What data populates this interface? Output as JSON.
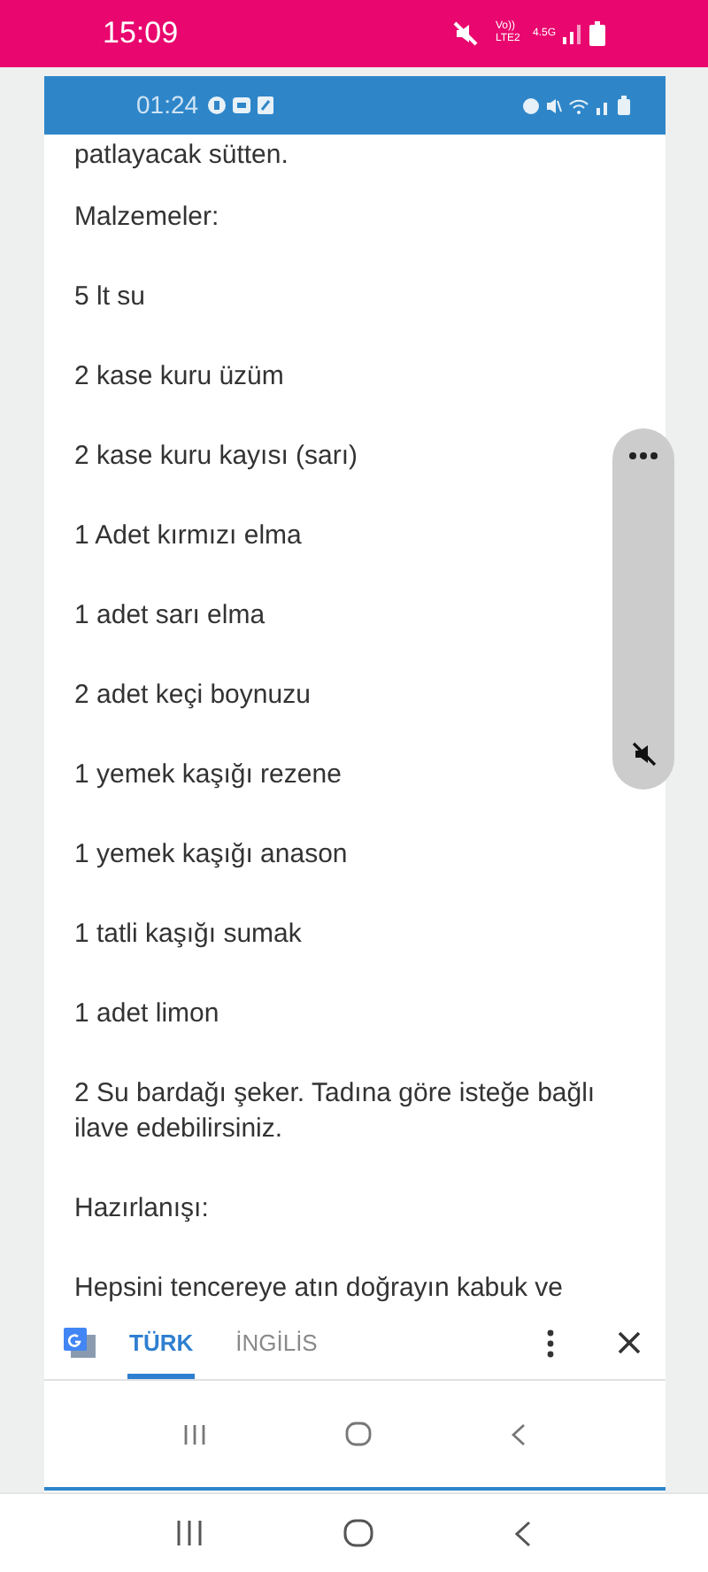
{
  "status_bar": {
    "time": "15:09",
    "volte": "Vo)) LTE2",
    "network": "4.5G"
  },
  "inner_status_bar": {
    "time": "01:24"
  },
  "article": {
    "paragraphs": [
      "patlayacak sütten.",
      "Malzemeler:",
      "5 lt su",
      "2  kase kuru üzüm",
      "2  kase kuru kayısı (sarı)",
      "1 Adet kırmızı elma",
      "1 adet sarı elma",
      "2 adet keçi boynuzu",
      "1 yemek kaşığı rezene",
      "1 yemek kaşığı anason",
      "1 tatli kaşığı sumak",
      "1 adet limon",
      "2 Su bardağı şeker.  Tadına göre isteğe bağlı ilave edebilirsiniz.",
      "Hazırlanışı:",
      "Hepsini tencereye atın doğrayın kabuk ve"
    ]
  },
  "translate_bar": {
    "tabs": [
      {
        "label": "TÜRK",
        "selected": true
      },
      {
        "label": "İNGİLİS",
        "selected": false
      }
    ]
  },
  "volume_panel": {
    "muted": true
  }
}
